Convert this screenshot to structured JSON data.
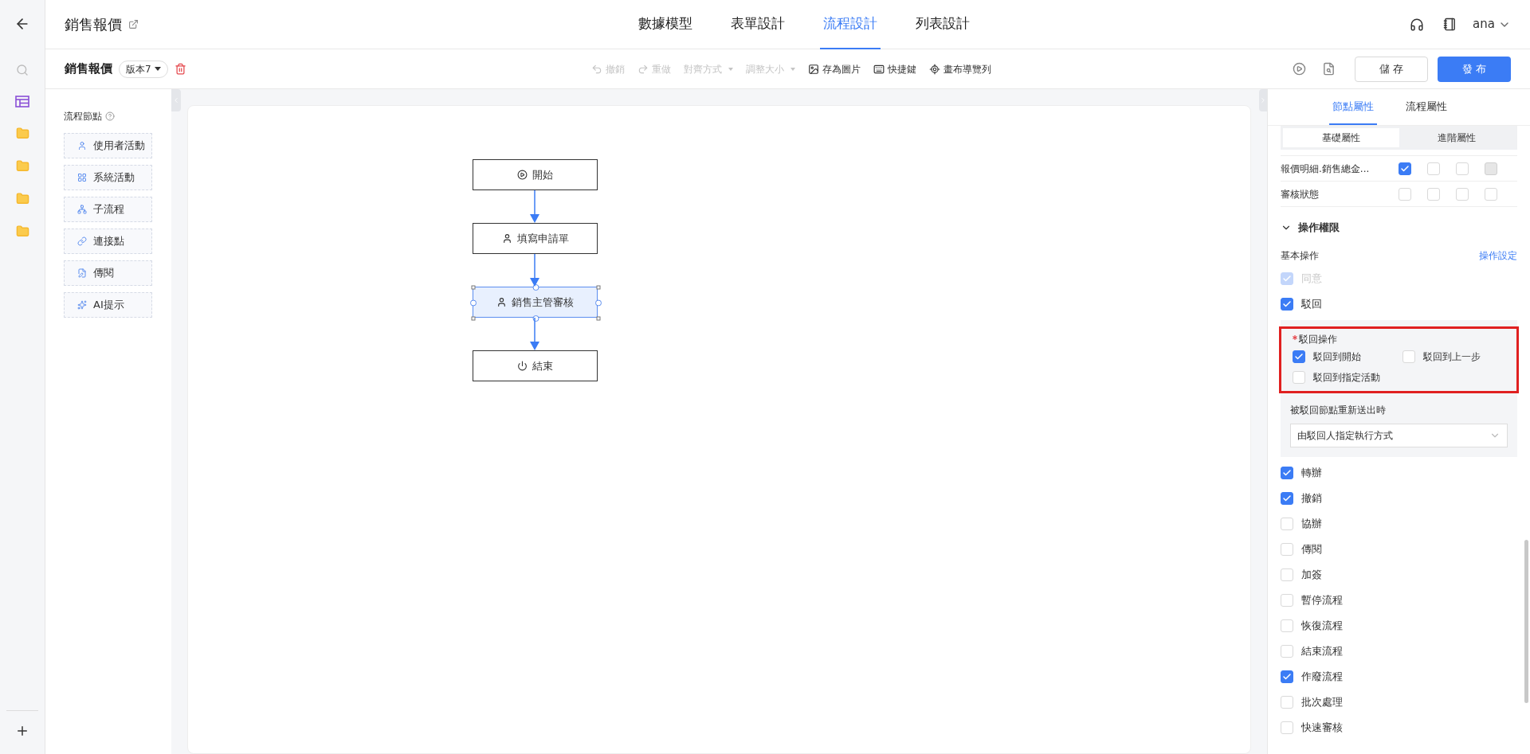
{
  "header": {
    "title": "銷售報價",
    "tabs": [
      {
        "label": "數據模型",
        "selected": false
      },
      {
        "label": "表單設計",
        "selected": false
      },
      {
        "label": "流程設計",
        "selected": true
      },
      {
        "label": "列表設計",
        "selected": false
      }
    ],
    "user": "ana"
  },
  "toolbar": {
    "process_name": "銷售報價",
    "version": "版本7",
    "tools": [
      {
        "label": "撤銷",
        "kind": "undo",
        "disabled": true,
        "dropdown": false
      },
      {
        "label": "重做",
        "kind": "redo",
        "disabled": true,
        "dropdown": false
      },
      {
        "label": "對齊方式",
        "kind": "align",
        "disabled": true,
        "dropdown": true
      },
      {
        "label": "調整大小",
        "kind": "resize",
        "disabled": true,
        "dropdown": true
      },
      {
        "label": "存為圖片",
        "kind": "image",
        "disabled": false,
        "dropdown": false
      },
      {
        "label": "快捷鍵",
        "kind": "keyboard",
        "disabled": false,
        "dropdown": false
      },
      {
        "label": "畫布導覽列",
        "kind": "navigator",
        "disabled": false,
        "dropdown": false
      }
    ],
    "save": "儲 存",
    "publish": "發 布"
  },
  "palette": {
    "title": "流程節點",
    "items": [
      {
        "label": "使用者活動",
        "kind": "user"
      },
      {
        "label": "系統活動",
        "kind": "system"
      },
      {
        "label": "子流程",
        "kind": "subflow"
      },
      {
        "label": "連接點",
        "kind": "link"
      },
      {
        "label": "傳閱",
        "kind": "circulate"
      },
      {
        "label": "AI提示",
        "kind": "ai"
      }
    ]
  },
  "canvas": {
    "nodes": [
      {
        "label": "開始",
        "kind": "start",
        "selected": false
      },
      {
        "label": "填寫申請單",
        "kind": "user",
        "selected": false
      },
      {
        "label": "銷售主管審核",
        "kind": "user",
        "selected": true
      },
      {
        "label": "結束",
        "kind": "end",
        "selected": false
      }
    ]
  },
  "panel": {
    "tabs": [
      {
        "label": "節點屬性",
        "selected": true
      },
      {
        "label": "流程屬性",
        "selected": false
      }
    ],
    "subtabs": [
      {
        "label": "基礎屬性",
        "selected": true
      },
      {
        "label": "進階屬性",
        "selected": false
      }
    ],
    "field_rows": [
      {
        "name": "報價明細.銷售總金...",
        "permissions": [
          {
            "checked": true,
            "disabled": false
          },
          {
            "checked": false,
            "disabled": false
          },
          {
            "checked": false,
            "disabled": false
          },
          {
            "checked": false,
            "disabled": true
          }
        ]
      },
      {
        "name": "審核狀態",
        "permissions": [
          {
            "checked": false,
            "disabled": false
          },
          {
            "checked": false,
            "disabled": false
          },
          {
            "checked": false,
            "disabled": false
          },
          {
            "checked": false,
            "disabled": false
          }
        ]
      }
    ],
    "section": {
      "title": "操作權限",
      "expanded": true
    },
    "basic_ops_label": "基本操作",
    "settings_link": "操作設定",
    "ops_before": [
      {
        "label": "同意",
        "checked": true,
        "disabled": true
      },
      {
        "label": "駁回",
        "checked": true,
        "disabled": false
      }
    ],
    "reject": {
      "title": "駁回操作",
      "required": true,
      "highlighted": true,
      "options": [
        {
          "label": "駁回到開始",
          "checked": true
        },
        {
          "label": "駁回到上一步",
          "checked": false
        },
        {
          "label": "駁回到指定活動",
          "checked": false
        }
      ],
      "resubmit_label": "被駁回節點重新送出時",
      "resubmit_value": "由駁回人指定執行方式"
    },
    "ops_after": [
      {
        "label": "轉辦",
        "checked": true,
        "disabled": false
      },
      {
        "label": "撤銷",
        "checked": true,
        "disabled": false
      },
      {
        "label": "協辦",
        "checked": false,
        "disabled": false
      },
      {
        "label": "傳閱",
        "checked": false,
        "disabled": false
      },
      {
        "label": "加簽",
        "checked": false,
        "disabled": false
      },
      {
        "label": "暫停流程",
        "checked": false,
        "disabled": false
      },
      {
        "label": "恢復流程",
        "checked": false,
        "disabled": false
      },
      {
        "label": "結束流程",
        "checked": false,
        "disabled": false
      },
      {
        "label": "作廢流程",
        "checked": true,
        "disabled": false
      },
      {
        "label": "批次處理",
        "checked": false,
        "disabled": false
      },
      {
        "label": "快速審核",
        "checked": false,
        "disabled": false
      }
    ]
  }
}
